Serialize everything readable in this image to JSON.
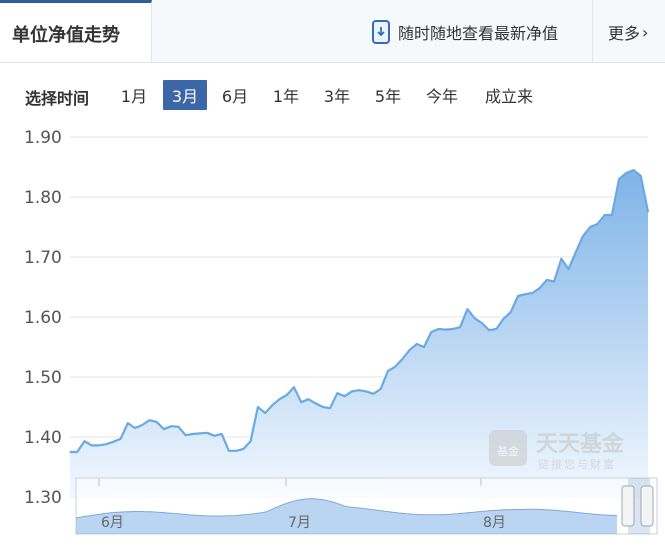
{
  "header": {
    "title": "单位净值走势",
    "promo_text": "随时随地查看最新净值",
    "more_label": "更多",
    "more_chevron": "›"
  },
  "filters": {
    "label": "选择时间",
    "options": [
      "1月",
      "3月",
      "6月",
      "1年",
      "3年",
      "5年",
      "今年",
      "成立来"
    ],
    "active": "3月"
  },
  "watermark": {
    "logo_text": "基金",
    "brand": "天天基金",
    "slogan": "链接您与财富"
  },
  "chart_data": {
    "type": "area",
    "title": "",
    "xlabel": "",
    "ylabel": "",
    "ylim": [
      1.3,
      1.9
    ],
    "yticks": [
      "1.90",
      "1.80",
      "1.70",
      "1.60",
      "1.50",
      "1.40",
      "1.30"
    ],
    "navigator_labels": [
      "6月",
      "7月",
      "8月"
    ],
    "series": [
      {
        "values": [
          1.375,
          1.375,
          1.393,
          1.386,
          1.386,
          1.388,
          1.392,
          1.397,
          1.423,
          1.415,
          1.42,
          1.428,
          1.425,
          1.413,
          1.418,
          1.417,
          1.403,
          1.405,
          1.406,
          1.407,
          1.402,
          1.405,
          1.377,
          1.377,
          1.38,
          1.393,
          1.45,
          1.44,
          1.453,
          1.463,
          1.47,
          1.483,
          1.458,
          1.463,
          1.456,
          1.45,
          1.448,
          1.473,
          1.468,
          1.476,
          1.478,
          1.476,
          1.472,
          1.48,
          1.51,
          1.517,
          1.53,
          1.545,
          1.555,
          1.55,
          1.575,
          1.58,
          1.579,
          1.58,
          1.583,
          1.613,
          1.598,
          1.59,
          1.578,
          1.58,
          1.597,
          1.608,
          1.635,
          1.638,
          1.64,
          1.648,
          1.662,
          1.659,
          1.697,
          1.68,
          1.708,
          1.735,
          1.75,
          1.755,
          1.77,
          1.77,
          1.83,
          1.84,
          1.845,
          1.835,
          1.775
        ]
      }
    ],
    "colors": {
      "line": "#6aaae4",
      "fill_top": "#7fb3e8",
      "fill_bottom": "#f2f8fe",
      "grid": "#e6e6e6",
      "accent": "#3b66a7"
    },
    "grid": true
  }
}
